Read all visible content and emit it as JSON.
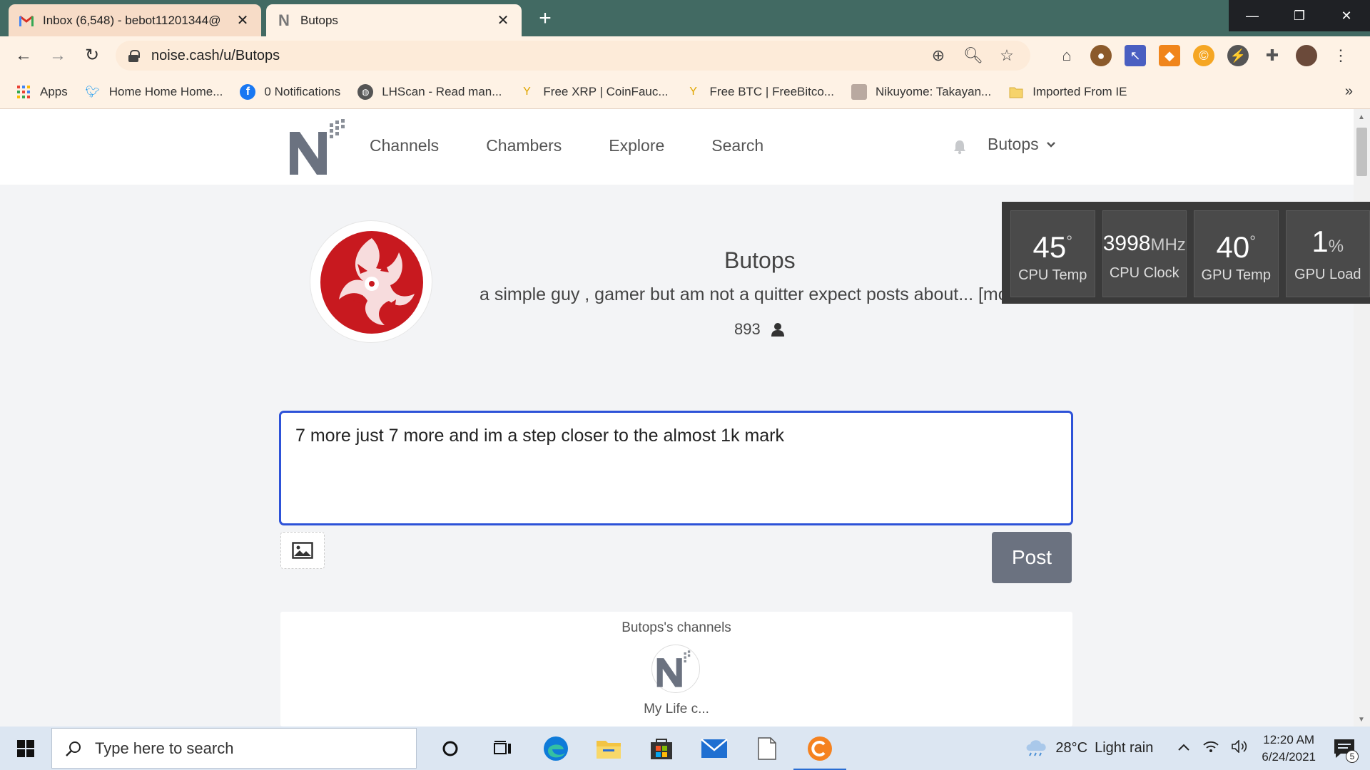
{
  "browser": {
    "tabs": [
      {
        "title": "Inbox (6,548) - bebot11201344@",
        "active": false,
        "favicon": "gmail-icon"
      },
      {
        "title": "Butops",
        "active": true,
        "favicon": "noise-icon"
      }
    ],
    "url": "noise.cash/u/Butops",
    "bookmarks": [
      {
        "label": "Apps",
        "icon": "apps-grid-icon"
      },
      {
        "label": "Home Home Home...",
        "icon": "twitter-icon"
      },
      {
        "label": "0 Notifications",
        "icon": "facebook-icon"
      },
      {
        "label": "LHScan - Read man...",
        "icon": "globe-icon"
      },
      {
        "label": "Free XRP | CoinFauc...",
        "icon": "faucet-icon"
      },
      {
        "label": "Free BTC | FreeBitco...",
        "icon": "faucet-icon"
      },
      {
        "label": "Nikuyome: Takayan...",
        "icon": "manga-icon"
      },
      {
        "label": "Imported From IE",
        "icon": "folder-icon"
      }
    ]
  },
  "site": {
    "nav": [
      "Channels",
      "Chambers",
      "Explore",
      "Search"
    ],
    "user": "Butops"
  },
  "profile": {
    "name": "Butops",
    "bio": "a simple guy , gamer but am not a quitter expect posts about... [more]",
    "followers": "893"
  },
  "composer": {
    "text": "7 more just 7 more and im a step closer to the almost 1k mark",
    "post_label": "Post"
  },
  "channels": {
    "title": "Butops's channels",
    "items": [
      {
        "label": "My Life c..."
      }
    ]
  },
  "hardware": [
    {
      "value": "45",
      "unit": "°",
      "label": "CPU Temp"
    },
    {
      "value": "3998",
      "unit": "MHz",
      "label": "CPU Clock"
    },
    {
      "value": "40",
      "unit": "°",
      "label": "GPU Temp"
    },
    {
      "value": "1",
      "unit": "%",
      "label": "GPU Load"
    }
  ],
  "taskbar": {
    "search_placeholder": "Type here to search",
    "weather_temp": "28°C",
    "weather_desc": "Light rain",
    "time": "12:20 AM",
    "date": "6/24/2021",
    "notifications": "5"
  },
  "colors": {
    "tabstrip": "#426a63",
    "chrome": "#fef2e5",
    "focus_border": "#2d52d8",
    "post_button": "#6b7280"
  }
}
